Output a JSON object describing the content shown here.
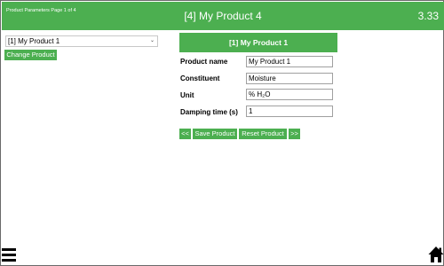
{
  "header": {
    "page_info": "Product Parameters Page 1 of 4",
    "title": "[4] My Product 4",
    "version": "3.33"
  },
  "left": {
    "product_select_value": "[1] My Product 1",
    "change_product_label": "Change Product"
  },
  "form": {
    "section_title": "[1] My Product 1",
    "fields": [
      {
        "label": "Product name",
        "value": "My Product 1"
      },
      {
        "label": "Constituent",
        "value": "Moisture"
      },
      {
        "label": "Unit",
        "value": "% H₂O"
      },
      {
        "label": "Damping time (s)",
        "value": "1"
      }
    ],
    "buttons": {
      "prev": "<<",
      "save": "Save Product",
      "reset": "Reset Product",
      "next": ">>"
    }
  },
  "footer": {
    "menu_icon": "hamburger-menu-icon",
    "home_icon": "home-icon"
  },
  "colors": {
    "accent": "#4caf50",
    "text": "#000000",
    "background": "#ffffff"
  }
}
